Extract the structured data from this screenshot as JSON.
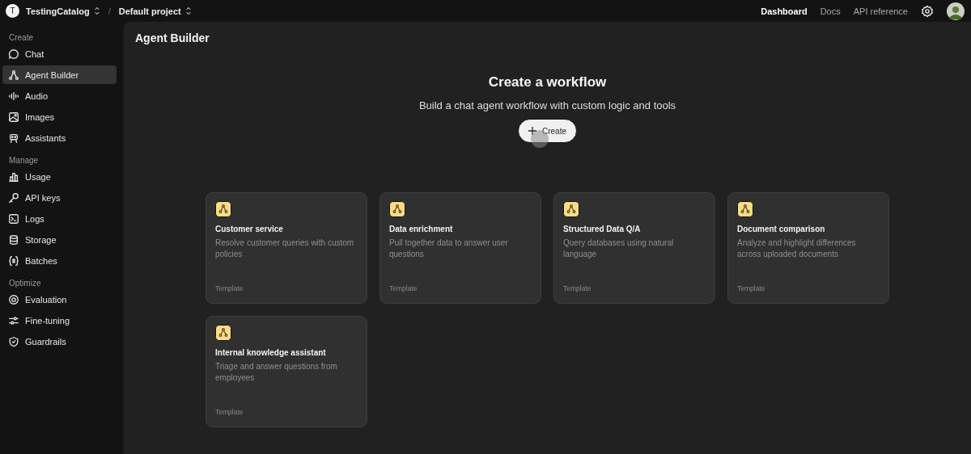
{
  "topbar": {
    "org": {
      "initial": "T",
      "name": "TestingCatalog"
    },
    "separator": "/",
    "project": "Default project",
    "nav": [
      {
        "label": "Dashboard",
        "selected": true
      },
      {
        "label": "Docs",
        "selected": false
      },
      {
        "label": "API reference",
        "selected": false
      }
    ]
  },
  "sidebar": {
    "sections": [
      {
        "title": "Create",
        "items": [
          {
            "label": "Chat",
            "selected": false
          },
          {
            "label": "Agent Builder",
            "selected": true
          },
          {
            "label": "Audio",
            "selected": false
          },
          {
            "label": "Images",
            "selected": false
          },
          {
            "label": "Assistants",
            "selected": false
          }
        ]
      },
      {
        "title": "Manage",
        "items": [
          {
            "label": "Usage",
            "selected": false
          },
          {
            "label": "API keys",
            "selected": false
          },
          {
            "label": "Logs",
            "selected": false
          },
          {
            "label": "Storage",
            "selected": false
          },
          {
            "label": "Batches",
            "selected": false
          }
        ]
      },
      {
        "title": "Optimize",
        "items": [
          {
            "label": "Evaluation",
            "selected": false
          },
          {
            "label": "Fine-tuning",
            "selected": false
          },
          {
            "label": "Guardrails",
            "selected": false
          }
        ]
      }
    ]
  },
  "page": {
    "title": "Agent Builder",
    "hero": {
      "title": "Create a workflow",
      "subtitle": "Build a chat agent workflow with custom logic and tools",
      "button": "Create"
    },
    "templates": [
      {
        "title": "Customer service",
        "description": "Resolve customer queries with custom policies",
        "tag": "Template"
      },
      {
        "title": "Data enrichment",
        "description": "Pull together data to answer user questions",
        "tag": "Template"
      },
      {
        "title": "Structured Data Q/A",
        "description": "Query databases using natural language",
        "tag": "Template"
      },
      {
        "title": "Document comparison",
        "description": "Analyze and highlight differences across uploaded documents",
        "tag": "Template"
      },
      {
        "title": "Internal knowledge assistant",
        "description": "Triage and answer questions from employees",
        "tag": "Template"
      }
    ]
  }
}
